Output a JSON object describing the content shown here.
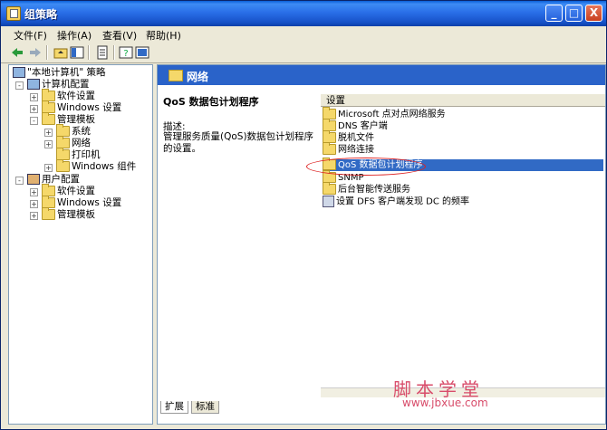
{
  "window": {
    "title": "组策略",
    "min_glyph": "_",
    "max_glyph": "□",
    "close_glyph": "X"
  },
  "menu": [
    "文件(F)",
    "操作(A)",
    "查看(V)",
    "帮助(H)"
  ],
  "tree": {
    "root": "\"本地计算机\" 策略",
    "computer_config": "计算机配置",
    "software_settings": "软件设置",
    "windows_settings": "Windows 设置",
    "admin_templates": "管理模板",
    "system": "系统",
    "network": "网络",
    "printers": "打印机",
    "windows_components": "Windows 组件",
    "user_config": "用户配置",
    "user_software_settings": "软件设置",
    "user_windows_settings": "Windows 设置",
    "user_admin_templates": "管理模板"
  },
  "right_header": "网络",
  "description": {
    "title": "QoS 数据包计划程序",
    "label": "描述:",
    "text": "管理服务质量(QoS)数据包计划程序的设置。"
  },
  "list_header": "设置",
  "list": [
    {
      "label": "Microsoft 点对点网络服务",
      "icon": "folder"
    },
    {
      "label": "DNS 客户端",
      "icon": "folder"
    },
    {
      "label": "脱机文件",
      "icon": "folder"
    },
    {
      "label": "网络连接",
      "icon": "folder"
    },
    {
      "label": "QoS 数据包计划程序",
      "icon": "folder",
      "selected": true
    },
    {
      "label": "SNMP",
      "icon": "folder"
    },
    {
      "label": "后台智能传送服务",
      "icon": "folder"
    },
    {
      "label": "设置 DFS 客户端发现 DC 的频率",
      "icon": "setting"
    }
  ],
  "tabs": [
    "扩展",
    "标准"
  ],
  "watermark": {
    "text": "脚本学堂",
    "url": "www.jbxue.com"
  },
  "colors": {
    "accent": "#316ac5",
    "header": "#2a63c9",
    "annotation": "#dd2222"
  }
}
